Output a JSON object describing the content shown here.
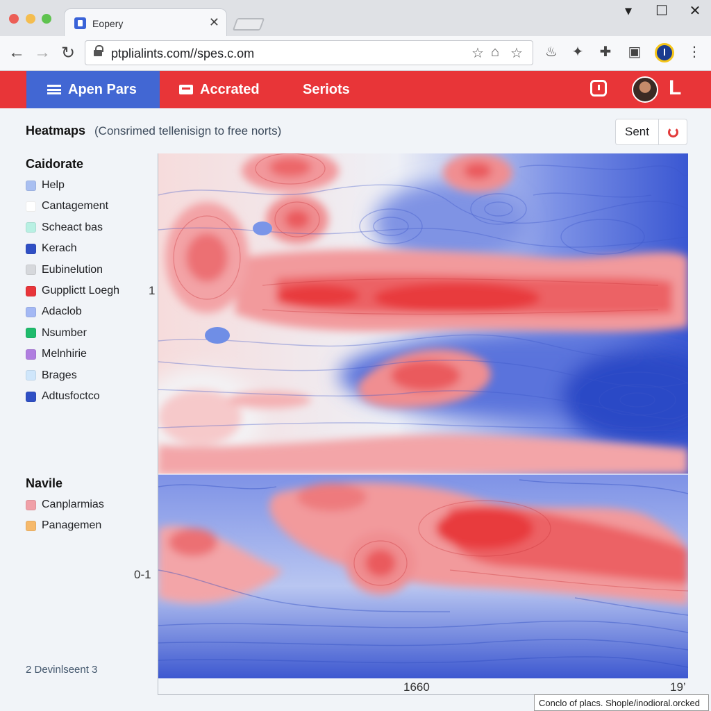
{
  "browser": {
    "tab_title": "Eopery",
    "url": "ptplialints.com//spes.c.om",
    "colors": {
      "tabbar": "#dfe1e5",
      "toolbar": "#f7f8fa"
    }
  },
  "appbar": {
    "nav": [
      {
        "label": "Apen Pars",
        "icon": "hamburger-icon",
        "active": true
      },
      {
        "label": "Accrated",
        "icon": "card-icon",
        "active": false
      },
      {
        "label": "Seriots",
        "icon": "",
        "active": false
      }
    ],
    "logo": "L",
    "colors": {
      "bar": "#e83538",
      "active": "#4267d3"
    }
  },
  "page": {
    "title": "Heatmaps",
    "subtitle": "(Consrimed tellenisign to free norts)",
    "sent_button": "Sent",
    "refresh_icon": "refresh-icon"
  },
  "sidebar": {
    "section1_title": "Caidorate",
    "section1_items": [
      {
        "label": "Help",
        "color": "#a9bff1"
      },
      {
        "label": "Cantagement",
        "color": "#ffffff"
      },
      {
        "label": "Scheact bas",
        "color": "#b8f0e3"
      },
      {
        "label": "Kerach",
        "color": "#2f4fc4"
      },
      {
        "label": "Eubinelution",
        "color": "#d6d8dc"
      },
      {
        "label": "Gupplictt Loegh",
        "color": "#e8353a"
      },
      {
        "label": "Adaclob",
        "color": "#a3b8f4"
      },
      {
        "label": "Nsumber",
        "color": "#1fbb6c"
      },
      {
        "label": "Melnhirie",
        "color": "#b07ee0"
      },
      {
        "label": "Brages",
        "color": "#cfe6fb"
      },
      {
        "label": "Adtusfoctco",
        "color": "#2f4fc4"
      }
    ],
    "section2_title": "Navile",
    "section2_items": [
      {
        "label": "Canplarmias",
        "color": "#f0a0a8"
      },
      {
        "label": "Panagemen",
        "color": "#f6b96b"
      }
    ],
    "footer": "2 Devinlseent 3"
  },
  "chart": {
    "y_label_top": "1",
    "y_label_bottom": "0-1",
    "x_label_mid": "1660",
    "x_label_end": "19’",
    "colors": {
      "hot": "#e8353a",
      "mid": "#f4f4f6",
      "cold": "#2f4fc4"
    }
  },
  "status_tip": "Conclo of placs. Shople/inodioral.orcked"
}
